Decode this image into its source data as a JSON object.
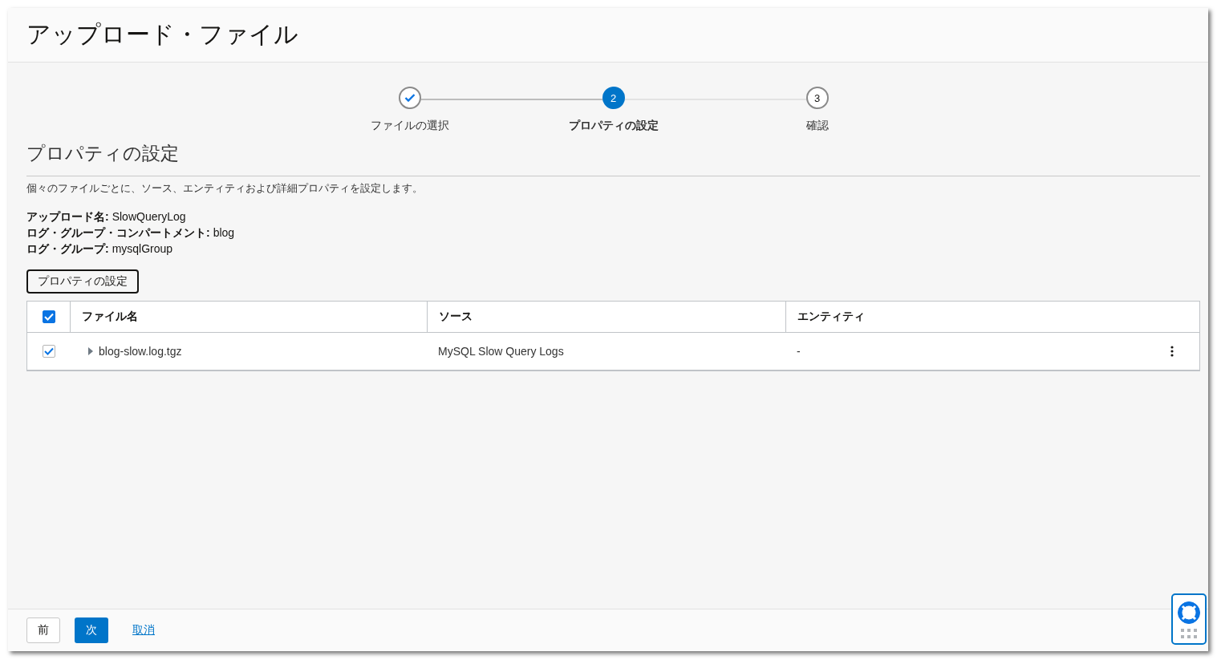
{
  "window": {
    "title": "アップロード・ファイル"
  },
  "steps": [
    {
      "label": "ファイルの選択",
      "completed": true,
      "selected": false
    },
    {
      "label": "プロパティの設定",
      "number": "2",
      "completed": false,
      "selected": true
    },
    {
      "label": "確認",
      "number": "3",
      "completed": false,
      "selected": false
    }
  ],
  "section": {
    "title": "プロパティの設定",
    "description": "個々のファイルごとに、ソース、エンティティおよび詳細プロパティを設定します。"
  },
  "info": [
    {
      "label": "アップロード名:",
      "value": "SlowQueryLog"
    },
    {
      "label": "ログ・グループ・コンパートメント:",
      "value": "blog"
    },
    {
      "label": "ログ・グループ:",
      "value": "mysqlGroup"
    }
  ],
  "set_properties_button": "プロパティの設定",
  "table": {
    "select_all_checked": true,
    "columns": [
      "ファイル名",
      "ソース",
      "エンティティ"
    ],
    "rows": [
      {
        "checked": true,
        "expanded": false,
        "file": "blog-slow.log.tgz",
        "source": "MySQL Slow Query Logs",
        "entity": "-"
      }
    ]
  },
  "footer": {
    "back": "前",
    "next": "次",
    "cancel": "取消"
  }
}
